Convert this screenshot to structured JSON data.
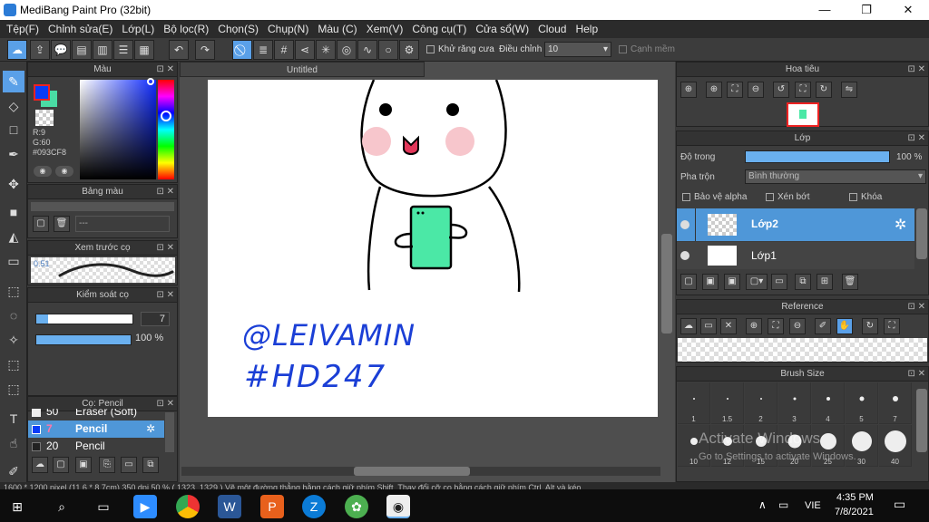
{
  "window": {
    "title": "MediBang Paint Pro (32bit)",
    "minimize": "—",
    "maximize": "❐",
    "close": "✕"
  },
  "menu": [
    "Tệp(F)",
    "Chỉnh sửa(E)",
    "Lớp(L)",
    "Bộ lọc(R)",
    "Chọn(S)",
    "Chụp(N)",
    "Màu (C)",
    "Xem(V)",
    "Công cụ(T)",
    "Cửa sổ(W)",
    "Cloud",
    "Help"
  ],
  "toolbar": {
    "antialias_label": "Khử răng cưa",
    "adjust_label": "Điều chỉnh",
    "adjust_value": "10",
    "sharp_label": "Cạnh mềm"
  },
  "color_panel": {
    "title": "Màu",
    "r": "R:9",
    "g": "G:60",
    "hex": "#093CF8",
    "fg_color": "#093CF8",
    "bg_color": "#4ADBA4"
  },
  "palette_panel": {
    "title": "Bảng màu",
    "row_text": "---"
  },
  "brush_preview": {
    "title": "Xem trước cọ",
    "size": "0.51"
  },
  "brush_control": {
    "title": "Kiểm soát cọ",
    "size_value": "7",
    "opacity_value": "100 %"
  },
  "brush_list": {
    "title": "Cọ: Pencil",
    "items": [
      {
        "size": "50",
        "name": "Eraser (Soft)"
      },
      {
        "size": "7",
        "name": "Pencil"
      },
      {
        "size": "20",
        "name": "Pencil"
      }
    ]
  },
  "document": {
    "tab": "Untitled",
    "sig1": "@LEIVAMIN",
    "sig2": "#HD247"
  },
  "navigator": {
    "title": "Hoa tiêu"
  },
  "layer_panel": {
    "title": "Lớp",
    "opacity_label": "Độ trong",
    "opacity_value": "100 %",
    "blend_label": "Pha trộn",
    "blend_value": "Bình thường",
    "protect_alpha": "Bảo vệ alpha",
    "clip": "Xén bớt",
    "lock": "Khóa",
    "layers": [
      {
        "name": "Lớp2",
        "selected": true
      },
      {
        "name": "Lớp1",
        "selected": false
      }
    ]
  },
  "reference_panel": {
    "title": "Reference"
  },
  "brush_size_panel": {
    "title": "Brush Size",
    "row1": [
      "1",
      "1.5",
      "2",
      "3",
      "4",
      "5",
      "7"
    ],
    "row2": [
      "10",
      "12",
      "15",
      "20",
      "25",
      "30",
      "40"
    ]
  },
  "watermark": {
    "line1": "Activate Windows",
    "line2": "Go to Settings to activate Windows."
  },
  "status": {
    "text": "1600 * 1200 pixel   (11.6 * 8.7cm)   350 dpi   50 %   ( 1323, 1329 )   Vẽ một đường thẳng bằng cách giữ phím Shift. Thay đổi cỡ cọ bằng cách giữ phím Ctrl, Alt và kéo."
  },
  "taskbar": {
    "lang": "VIE",
    "time": "4:35 PM",
    "date": "7/8/2021"
  }
}
